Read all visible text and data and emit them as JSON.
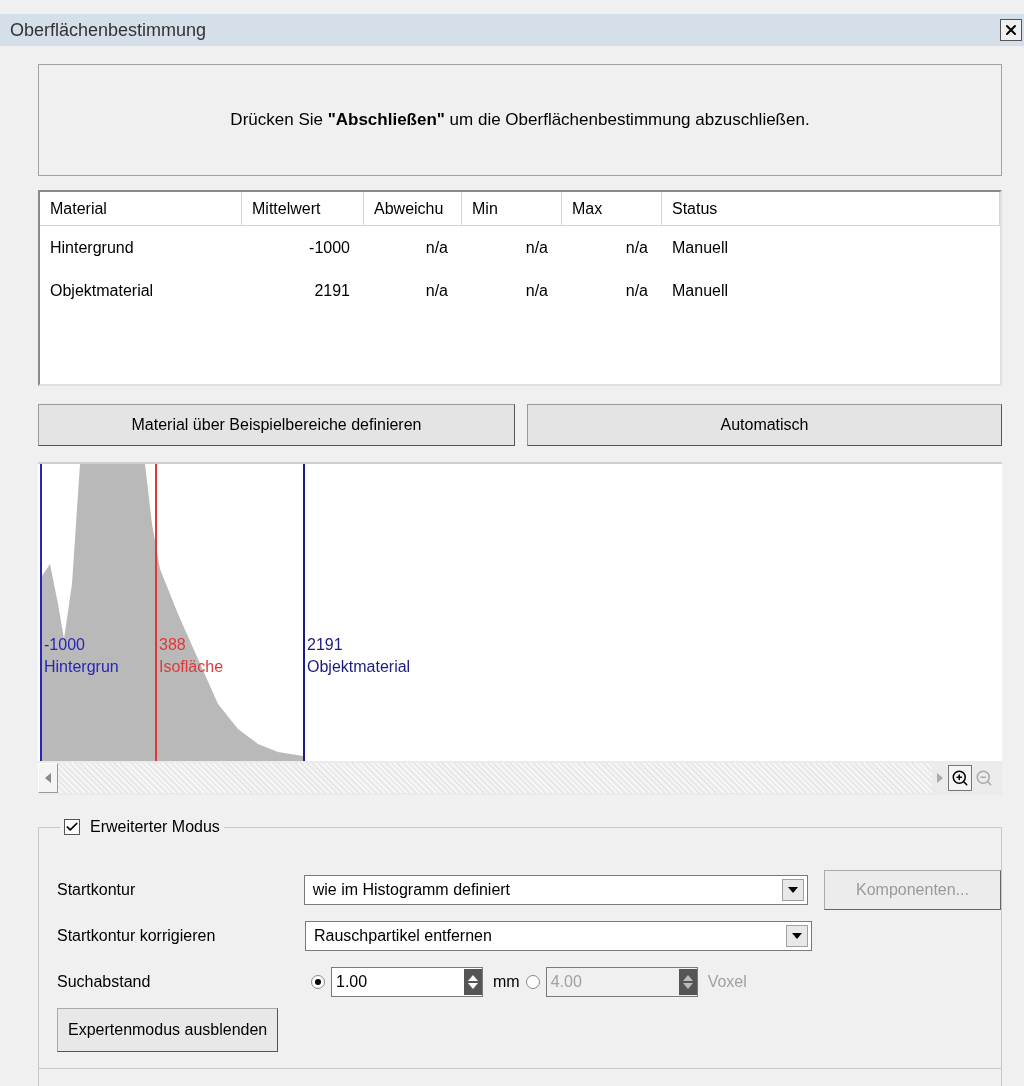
{
  "window": {
    "title": "Oberflächenbestimmung"
  },
  "instruction": "Drücken Sie **\"Abschließen\"** um die Oberflächenbestimmung abzuschließen.",
  "table": {
    "columns": [
      "Material",
      "Mittelwert",
      "Abweichu",
      "Min",
      "Max",
      "Status"
    ],
    "rows": [
      [
        "Hintergrund",
        "-1000",
        "n/a",
        "n/a",
        "n/a",
        "Manuell"
      ],
      [
        "Objektmaterial",
        "2191",
        "n/a",
        "n/a",
        "n/a",
        "Manuell"
      ]
    ]
  },
  "buttons": [
    "Material über Beispielbereiche definieren",
    "Automatisch"
  ],
  "histogram": {
    "markers": [
      {
        "value": "-1000",
        "label": "Hintergrun",
        "color": "#2626b8"
      },
      {
        "value": "388",
        "label": "Isofläche",
        "color": "#e03838"
      },
      {
        "value": "2191",
        "label": "Objektmaterial",
        "color": "#1c1c80"
      }
    ]
  },
  "expert": {
    "label": "Erweiterter Modus",
    "checked": true,
    "start_contour": {
      "label": "Startkontur",
      "value": "wie im Histogramm definiert",
      "button": {
        "label": "Komponenten...",
        "disabled": true
      }
    },
    "correction": {
      "label": "Startkontur korrigieren",
      "value": "Rauschpartikel entfernen"
    },
    "search_distance": {
      "label": "Suchabstand",
      "options": [
        {
          "value": "1.00",
          "unit": "mm",
          "selected": true,
          "disabled": false
        },
        {
          "value": "4.00",
          "unit": "Voxel",
          "selected": false,
          "disabled": true
        }
      ]
    },
    "toggle_button": "Expertenmodus ausblenden"
  }
}
